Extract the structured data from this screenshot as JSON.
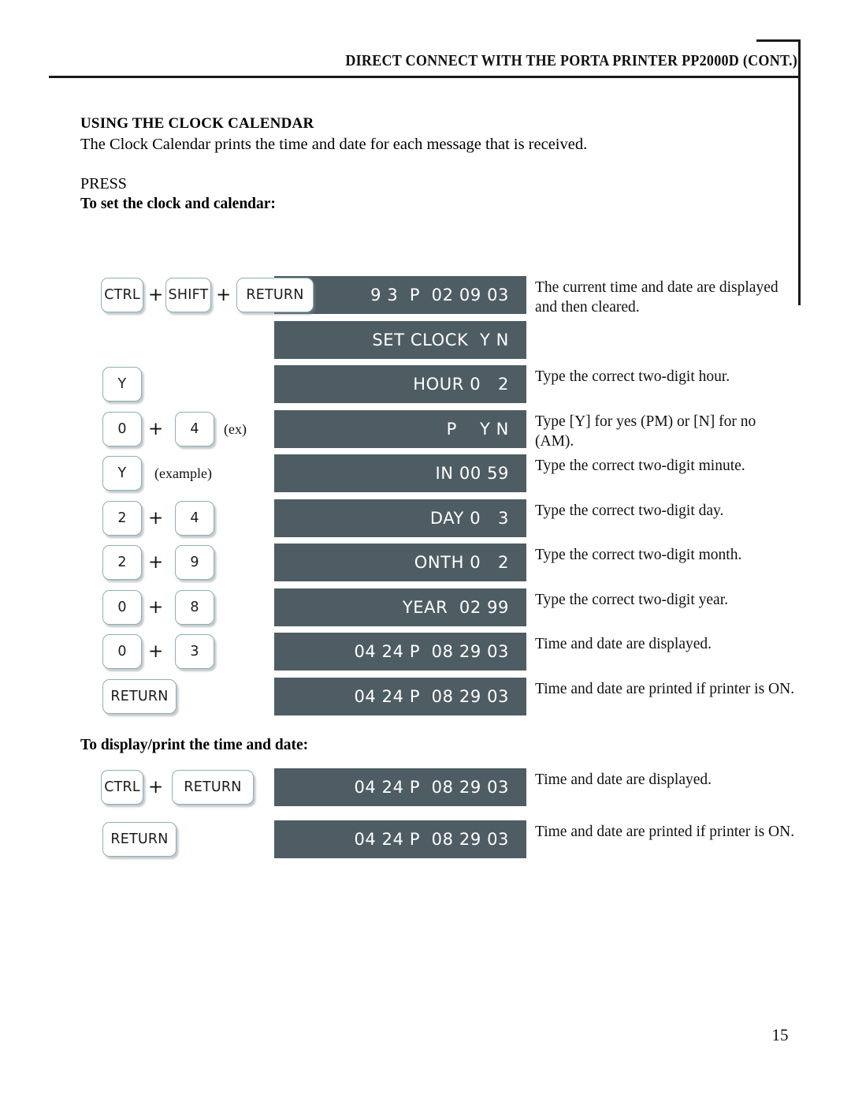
{
  "header": {
    "title": "DIRECT CONNECT WITH THE PORTA PRINTER PP2000D (CONT.)"
  },
  "page": {
    "number": "15"
  },
  "content": {
    "heading": "USING THE CLOCK CALENDAR",
    "intro": "The Clock Calendar prints the time and date for each message that is received.",
    "press_label": "PRESS",
    "subheading_set": "To set the clock and calendar:",
    "subheading_display": "To display/print the time and date:"
  },
  "colors": {
    "display_bg": "#4e5d63",
    "display_text": "#ffffff",
    "key_border": "#8fb0b4",
    "rule": "#1a1a1a"
  },
  "set_clock_rows": [
    {
      "keys": [
        "CTRL",
        "SHIFT",
        "RETURN"
      ],
      "plus": [
        "+",
        "+"
      ],
      "note": "",
      "display": "9 3  P  02 09 03",
      "desc": "The current time and date are displayed and then cleared."
    },
    {
      "keys": [],
      "plus": [],
      "note": "",
      "display": "SET CLOCK  Y N",
      "desc": ""
    },
    {
      "keys": [
        "Y"
      ],
      "plus": [],
      "note": "",
      "display": "HOUR 0   2",
      "desc": "Type the correct two-digit hour."
    },
    {
      "keys": [
        "0",
        "4"
      ],
      "plus": [
        "+"
      ],
      "note": "(ex)",
      "display": "P    Y N",
      "desc": "Type [Y] for yes (PM) or [N] for no (AM)."
    },
    {
      "keys": [
        "Y"
      ],
      "plus": [],
      "note": "(example)",
      "display": "IN 00 59",
      "desc": "Type the correct two-digit minute."
    },
    {
      "keys": [
        "2",
        "4"
      ],
      "plus": [
        "+"
      ],
      "note": "",
      "display": "DAY 0   3",
      "desc": "Type the correct two-digit day."
    },
    {
      "keys": [
        "2",
        "9"
      ],
      "plus": [
        "+"
      ],
      "note": "",
      "display": "ONTH 0   2",
      "desc": "Type the correct two-digit month."
    },
    {
      "keys": [
        "0",
        "8"
      ],
      "plus": [
        "+"
      ],
      "note": "",
      "display": "YEAR  02 99",
      "desc": "Type the correct two-digit year."
    },
    {
      "keys": [
        "0",
        "3"
      ],
      "plus": [
        "+"
      ],
      "note": "",
      "display": "04 24 P  08 29 03",
      "desc": "Time and date are displayed."
    },
    {
      "keys": [
        "RETURN"
      ],
      "plus": [],
      "note": "",
      "display": "04 24 P  08 29 03",
      "desc": "Time and date are printed if printer is ON."
    }
  ],
  "display_print_rows": [
    {
      "keys": [
        "CTRL",
        "RETURN"
      ],
      "plus": [
        "+"
      ],
      "note": "",
      "display": "04 24 P  08 29 03",
      "desc": "Time and date are displayed."
    },
    {
      "keys": [
        "RETURN"
      ],
      "plus": [],
      "note": "",
      "display": "04 24 P  08 29 03",
      "desc": "Time and date are printed if printer is ON."
    }
  ]
}
